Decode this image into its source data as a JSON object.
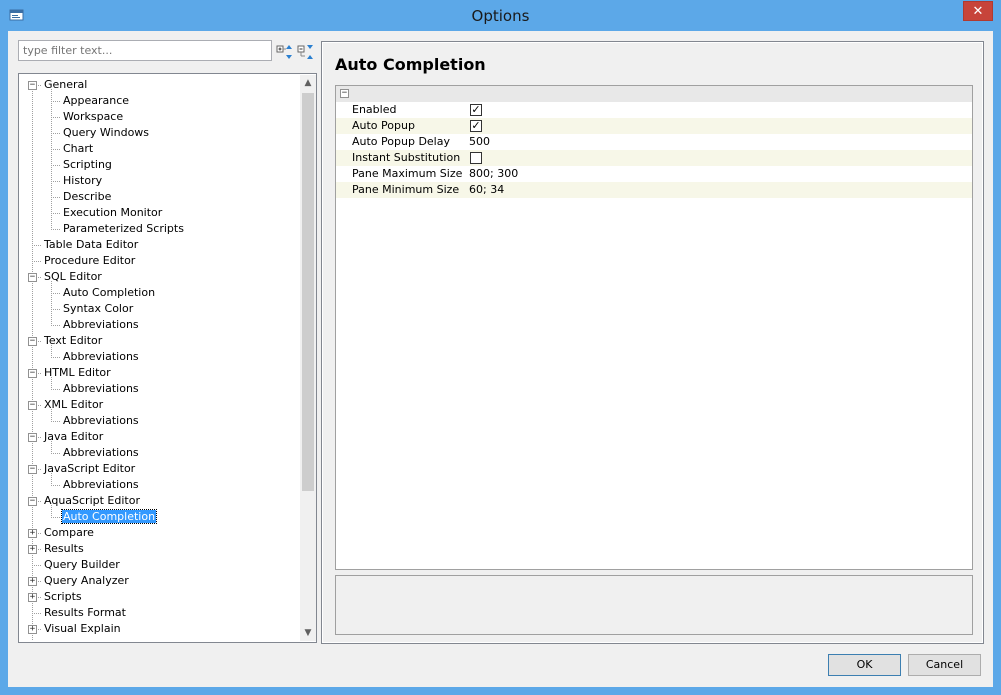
{
  "window": {
    "title": "Options",
    "close_glyph": "✕"
  },
  "filter": {
    "placeholder": "type filter text..."
  },
  "tree": {
    "items": [
      {
        "label": "General",
        "level": 0,
        "expander": "minus"
      },
      {
        "label": "Appearance",
        "level": 1
      },
      {
        "label": "Workspace",
        "level": 1
      },
      {
        "label": "Query Windows",
        "level": 1
      },
      {
        "label": "Chart",
        "level": 1
      },
      {
        "label": "Scripting",
        "level": 1
      },
      {
        "label": "History",
        "level": 1
      },
      {
        "label": "Describe",
        "level": 1
      },
      {
        "label": "Execution Monitor",
        "level": 1
      },
      {
        "label": "Parameterized Scripts",
        "level": 1
      },
      {
        "label": "Table Data Editor",
        "level": 0
      },
      {
        "label": "Procedure Editor",
        "level": 0
      },
      {
        "label": "SQL Editor",
        "level": 0,
        "expander": "minus"
      },
      {
        "label": "Auto Completion",
        "level": 1
      },
      {
        "label": "Syntax Color",
        "level": 1
      },
      {
        "label": "Abbreviations",
        "level": 1
      },
      {
        "label": "Text Editor",
        "level": 0,
        "expander": "minus"
      },
      {
        "label": "Abbreviations",
        "level": 1
      },
      {
        "label": "HTML Editor",
        "level": 0,
        "expander": "minus"
      },
      {
        "label": "Abbreviations",
        "level": 1
      },
      {
        "label": "XML Editor",
        "level": 0,
        "expander": "minus"
      },
      {
        "label": "Abbreviations",
        "level": 1
      },
      {
        "label": "Java Editor",
        "level": 0,
        "expander": "minus"
      },
      {
        "label": "Abbreviations",
        "level": 1
      },
      {
        "label": "JavaScript Editor",
        "level": 0,
        "expander": "minus"
      },
      {
        "label": "Abbreviations",
        "level": 1
      },
      {
        "label": "AquaScript Editor",
        "level": 0,
        "expander": "minus"
      },
      {
        "label": "Auto Completion",
        "level": 1,
        "selected": true
      },
      {
        "label": "Compare",
        "level": 0,
        "expander": "plus"
      },
      {
        "label": "Results",
        "level": 0,
        "expander": "plus"
      },
      {
        "label": "Query Builder",
        "level": 0
      },
      {
        "label": "Query Analyzer",
        "level": 0,
        "expander": "plus"
      },
      {
        "label": "Scripts",
        "level": 0,
        "expander": "plus"
      },
      {
        "label": "Results Format",
        "level": 0
      },
      {
        "label": "Visual Explain",
        "level": 0,
        "expander": "plus"
      }
    ]
  },
  "page": {
    "title": "Auto Completion",
    "properties": [
      {
        "name": "Enabled",
        "type": "checkbox",
        "checked": true
      },
      {
        "name": "Auto Popup",
        "type": "checkbox",
        "checked": true
      },
      {
        "name": "Auto Popup Delay",
        "type": "text",
        "value": "500"
      },
      {
        "name": "Instant Substitution",
        "type": "checkbox",
        "checked": false
      },
      {
        "name": "Pane Maximum Size",
        "type": "text",
        "value": "800; 300"
      },
      {
        "name": "Pane Minimum Size",
        "type": "text",
        "value": "60; 34"
      }
    ]
  },
  "buttons": {
    "ok": "OK",
    "cancel": "Cancel"
  },
  "colors": {
    "titlebar": "#5ca8e8",
    "selection": "#3399ff",
    "close": "#c7443a"
  }
}
